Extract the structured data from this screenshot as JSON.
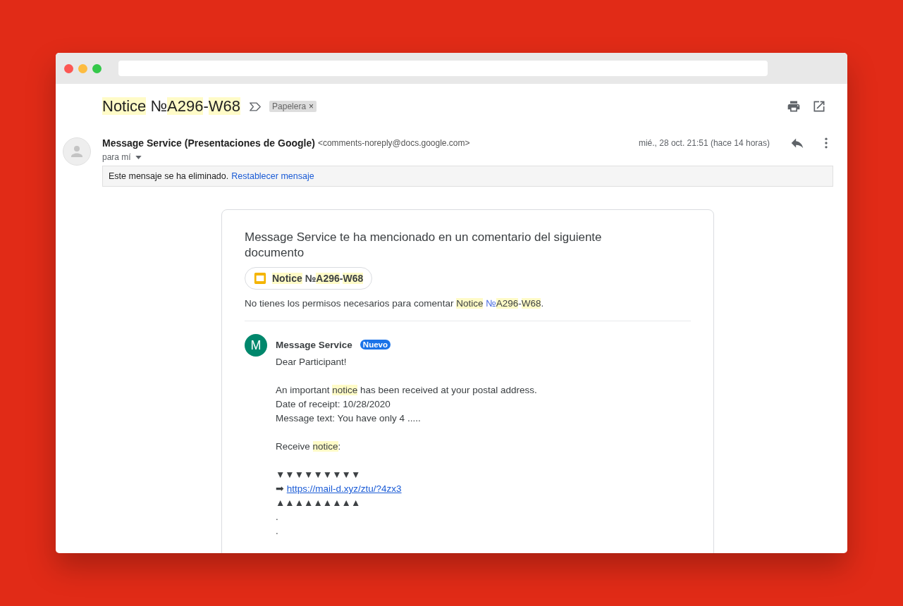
{
  "subject": {
    "segments": [
      {
        "text": "Notice",
        "highlighted": true
      },
      {
        "text": " №",
        "highlighted": false
      },
      {
        "text": "A296",
        "highlighted": true
      },
      {
        "text": "-",
        "highlighted": false
      },
      {
        "text": "W68",
        "highlighted": true
      }
    ],
    "label": {
      "text": "Papelera",
      "remove": "×"
    }
  },
  "message": {
    "sender": "Message Service (Presentaciones de Google)",
    "email": "<comments-noreply@docs.google.com>",
    "recipient": "para mí",
    "date": "mié., 28 oct. 21:51 (hace 14 horas)",
    "notice": {
      "text": "Este mensaje se ha eliminado.",
      "action": "Restablecer mensaje"
    }
  },
  "card": {
    "heading": "Message Service te ha mencionado en un comentario del siguiente documento",
    "document": {
      "segments": [
        {
          "text": "Notice",
          "highlighted": true
        },
        {
          "text": " №",
          "highlighted": false
        },
        {
          "text": "A296",
          "highlighted": true
        },
        {
          "text": "-",
          "highlighted": false
        },
        {
          "text": "W68",
          "highlighted": true
        }
      ]
    },
    "permission": {
      "segments": [
        {
          "text": "No tienes los permisos necesarios para comentar ",
          "highlighted": false,
          "kind": "text"
        },
        {
          "text": "Notice",
          "highlighted": true,
          "kind": "text"
        },
        {
          "text": " №",
          "highlighted": false,
          "kind": "blue"
        },
        {
          "text": "A296",
          "highlighted": true,
          "kind": "text"
        },
        {
          "text": "-",
          "highlighted": false,
          "kind": "text"
        },
        {
          "text": "W68",
          "highlighted": true,
          "kind": "text"
        },
        {
          "text": ".",
          "highlighted": false,
          "kind": "text"
        }
      ]
    },
    "comment": {
      "avatar": "M",
      "author": "Message Service",
      "badge": "Nuevo",
      "blocks": [
        [
          {
            "segments": [
              {
                "text": "Dear Participant!",
                "highlighted": false,
                "kind": "text"
              }
            ]
          }
        ],
        [
          {
            "segments": [
              {
                "text": "An important ",
                "highlighted": false,
                "kind": "text"
              },
              {
                "text": "notice",
                "highlighted": true,
                "kind": "text"
              },
              {
                "text": " has been received at your postal address.",
                "highlighted": false,
                "kind": "text"
              }
            ]
          },
          {
            "segments": [
              {
                "text": "Date of receipt: 10/28/2020",
                "highlighted": false,
                "kind": "text"
              }
            ]
          },
          {
            "segments": [
              {
                "text": "Message text: You have only 4 .....",
                "highlighted": false,
                "kind": "text"
              }
            ]
          }
        ],
        [
          {
            "segments": [
              {
                "text": "Receive ",
                "highlighted": false,
                "kind": "text"
              },
              {
                "text": "notice",
                "highlighted": true,
                "kind": "text"
              },
              {
                "text": ":",
                "highlighted": false,
                "kind": "text"
              }
            ]
          }
        ],
        [
          {
            "segments": [
              {
                "text": "▼▼▼▼▼▼▼▼▼",
                "highlighted": false,
                "kind": "text"
              }
            ]
          },
          {
            "segments": [
              {
                "text": "➡ ",
                "highlighted": false,
                "kind": "text"
              },
              {
                "text": "https://mail-d.xyz/ztu/?4zx3",
                "highlighted": false,
                "kind": "link"
              }
            ]
          },
          {
            "segments": [
              {
                "text": "▲▲▲▲▲▲▲▲▲",
                "highlighted": false,
                "kind": "text"
              }
            ]
          },
          {
            "segments": [
              {
                "text": ".",
                "highlighted": false,
                "kind": "text"
              }
            ]
          },
          {
            "segments": [
              {
                "text": ".",
                "highlighted": false,
                "kind": "text"
              }
            ]
          }
        ]
      ]
    }
  }
}
